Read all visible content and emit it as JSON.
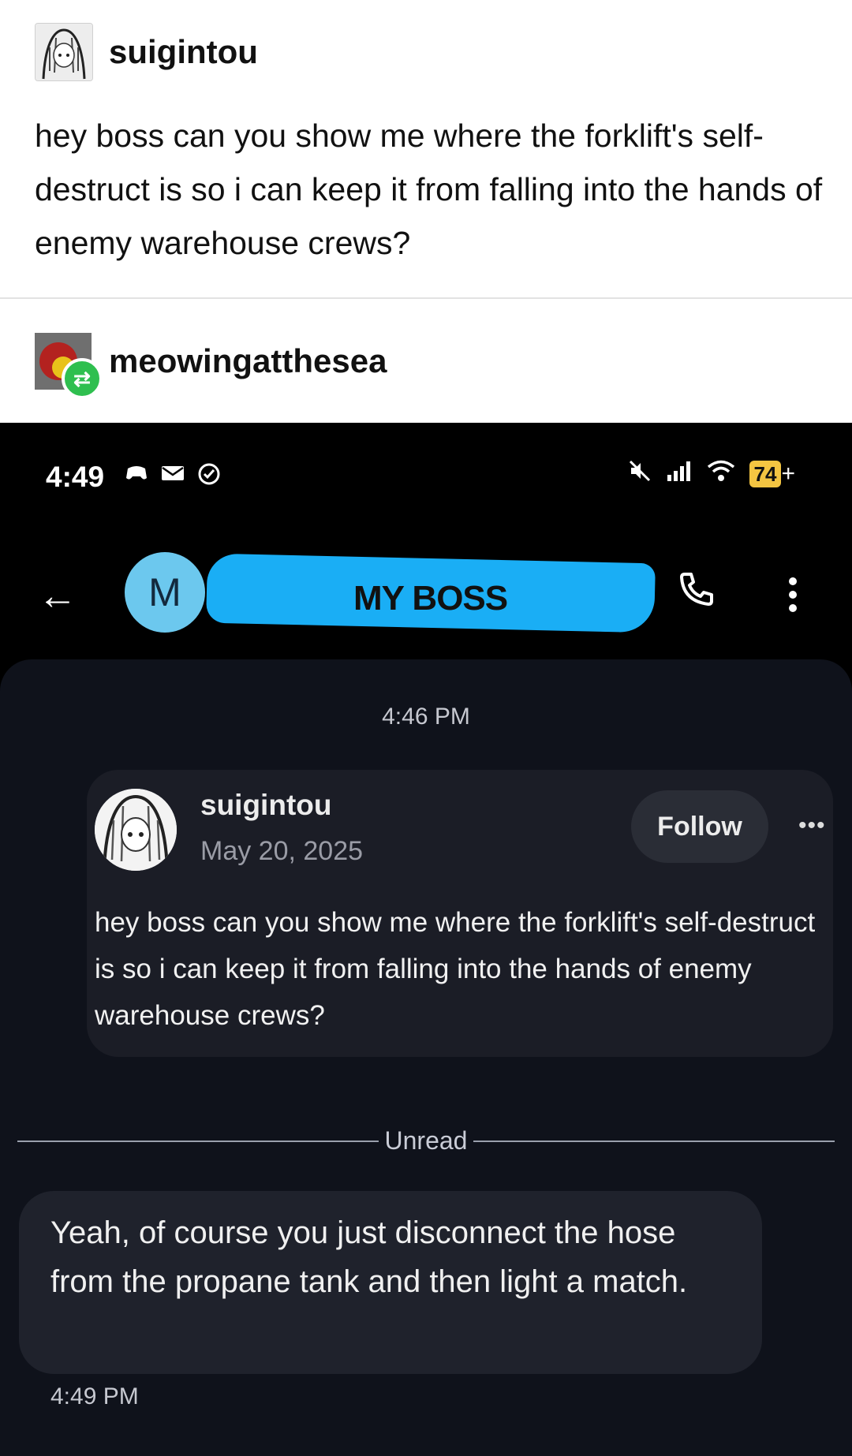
{
  "original_post": {
    "username": "suigintou",
    "text": "hey boss can you show me where the forklift's self-destruct is so i can keep it from falling into the hands of enemy warehouse crews?"
  },
  "reblog": {
    "username": "meowingatthesea",
    "badge_icon": "reblog-icon"
  },
  "phone": {
    "status_bar": {
      "time": "4:49",
      "battery": "74",
      "charging": "+"
    },
    "contact": {
      "initial": "M",
      "name": "MY BOSS"
    },
    "conversation": {
      "timestamp": "4:46 PM",
      "shared_post": {
        "username": "suigintou",
        "date": "May 20, 2025",
        "follow_label": "Follow",
        "text": "hey boss can you show me where the forklift's self-destruct is so i can keep it from falling into the hands of enemy warehouse crews?"
      },
      "unread_label": "Unread",
      "reply": {
        "text": "Yeah, of course you just disconnect the hose from the propane tank and then light a match.",
        "timestamp": "4:49 PM"
      }
    }
  },
  "colors": {
    "contact_avatar": "#6cc8ee",
    "scribble": "#1aaef5",
    "reblog_badge": "#2fbf4f",
    "battery": "#f4c542"
  }
}
